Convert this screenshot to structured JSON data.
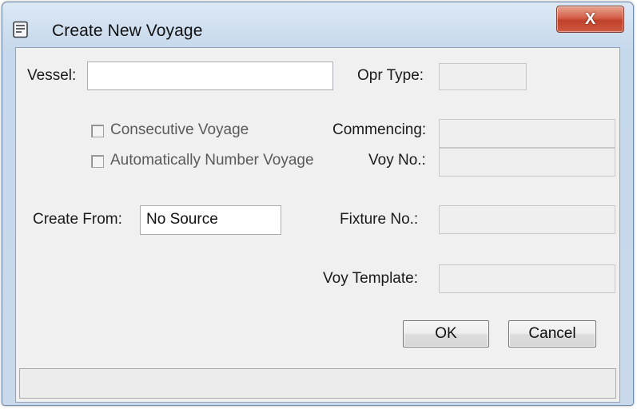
{
  "window": {
    "title": "Create New Voyage",
    "close_glyph": "X"
  },
  "icons": {
    "app": "form-icon",
    "close": "close-icon"
  },
  "fields": {
    "vessel": {
      "label": "Vessel:",
      "value": ""
    },
    "opr_type": {
      "label": "Opr Type:",
      "value": ""
    },
    "commencing": {
      "label": "Commencing:",
      "value": ""
    },
    "voy_no": {
      "label": "Voy No.:",
      "value": ""
    },
    "create_from": {
      "label": "Create From:",
      "value": "No Source"
    },
    "fixture_no": {
      "label": "Fixture No.:",
      "value": ""
    },
    "voy_template": {
      "label": "Voy Template:",
      "value": ""
    }
  },
  "checkboxes": {
    "consecutive": {
      "label": "Consecutive Voyage",
      "checked": false
    },
    "auto_number": {
      "label": "Automatically Number Voyage",
      "checked": false
    }
  },
  "buttons": {
    "ok": "OK",
    "cancel": "Cancel"
  },
  "status": {
    "text": ""
  },
  "colors": {
    "close_button": "#c9452f",
    "frame": "#c6d8ec"
  }
}
